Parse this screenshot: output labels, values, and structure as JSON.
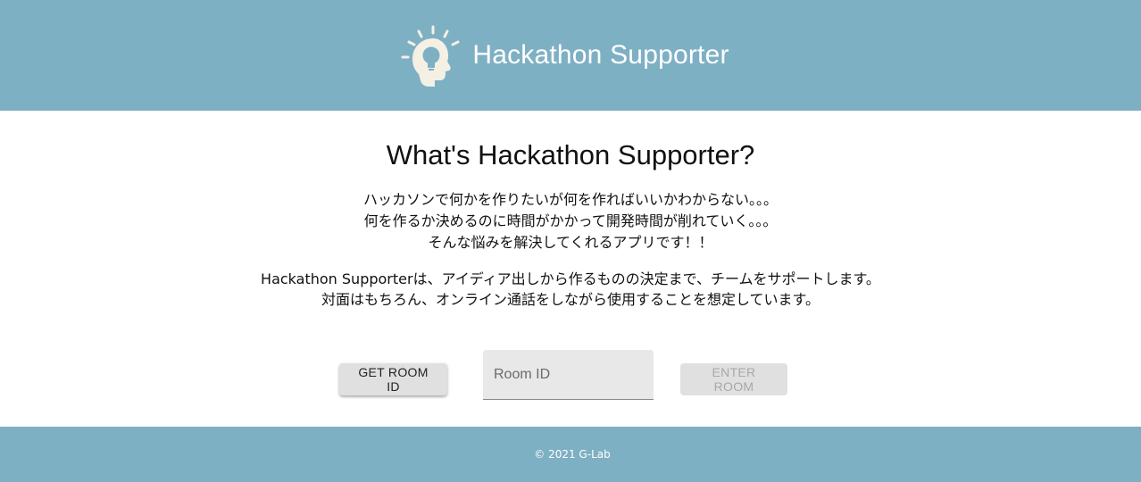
{
  "header": {
    "title": "Hackathon Supporter",
    "logo_icon": "lightbulb-head-icon",
    "background": "#7eb0c4"
  },
  "main": {
    "title": "What's Hackathon Supporter?",
    "intro_lines": [
      "ハッカソンで何かを作りたいが何を作ればいいかわからない。。。",
      "何を作るか決めるのに時間がかかって開発時間が削れていく。。。",
      "そんな悩みを解決してくれるアプリです！！"
    ],
    "description_lines": [
      "Hackathon Supporterは、アイディア出しから作るものの決定まで、チームをサポートします。",
      "対面はもちろん、オンライン通話をしながら使用することを想定しています。"
    ]
  },
  "controls": {
    "get_room_id_label": "GET ROOM ID",
    "room_id_placeholder": "Room ID",
    "room_id_value": "",
    "enter_room_label": "ENTER ROOM"
  },
  "footer": {
    "copyright": "© 2021 G-Lab"
  }
}
